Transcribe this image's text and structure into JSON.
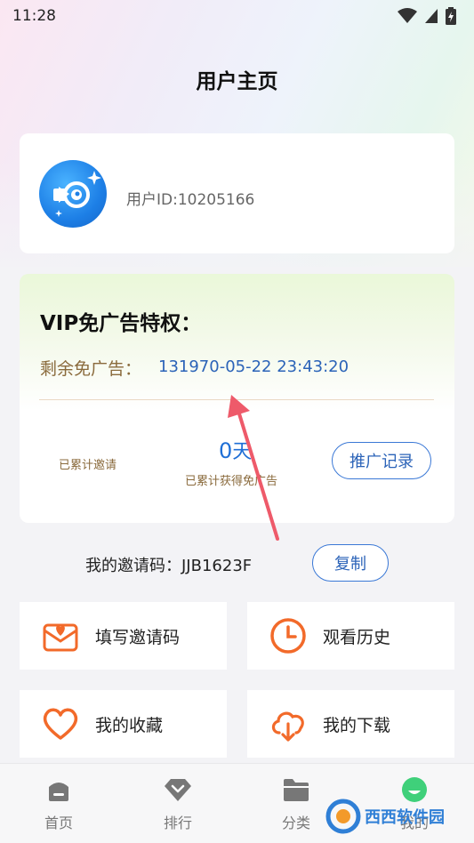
{
  "status_bar": {
    "time": "11:28",
    "icons": [
      "wifi-icon",
      "cellular-icon",
      "battery-charging-icon"
    ]
  },
  "page": {
    "title": "用户主页"
  },
  "user": {
    "id_text": "用户ID:10205166",
    "avatar": "app-logo-icon"
  },
  "vip": {
    "title": "VIP免广告特权：",
    "remaining_label": "剩余免广告：",
    "remaining_value": "131970-05-22 23:43:20",
    "invited_label": "已累计邀请",
    "earned_value": "0",
    "earned_unit": "天",
    "earned_label": "已累计获得免广告",
    "promo_button": "推广记录"
  },
  "invite": {
    "label": "我的邀请码：JJB1623F",
    "copy_button": "复制"
  },
  "tiles": [
    {
      "label": "填写邀请码",
      "icon": "mail-heart-icon"
    },
    {
      "label": "观看历史",
      "icon": "clock-icon"
    },
    {
      "label": "我的收藏",
      "icon": "heart-icon"
    },
    {
      "label": "我的下载",
      "icon": "cloud-download-icon"
    }
  ],
  "bottom_nav": [
    {
      "label": "首页",
      "icon": "home-icon"
    },
    {
      "label": "排行",
      "icon": "rank-icon"
    },
    {
      "label": "分类",
      "icon": "folder-icon"
    },
    {
      "label": "我的",
      "icon": "profile-icon"
    }
  ],
  "colors": {
    "accent_blue": "#2b63b8",
    "gold_text": "#8a6a3c",
    "icon_orange": "#f26a2a",
    "profile_green": "#3fd07a"
  },
  "watermark": {
    "text": "西西软件园"
  }
}
